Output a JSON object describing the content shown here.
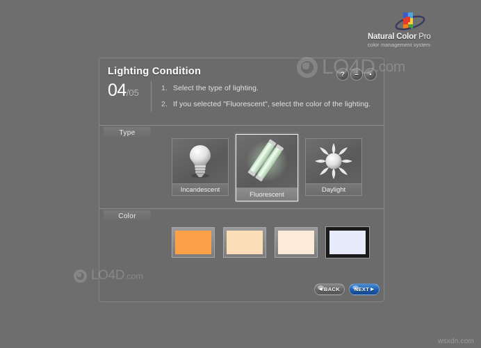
{
  "brand": {
    "name_part1": "Natural Color",
    "name_part2": " Pro",
    "tagline": "color management system",
    "logo_icon": "color-square-orbit-icon"
  },
  "header": {
    "title": "Lighting Condition",
    "step_current": "04",
    "step_total": "/05",
    "instructions": [
      {
        "num": "1.",
        "text": "Select the type of lighting."
      },
      {
        "num": "2.",
        "text": "If you selected \"Fluorescent\", select the color of the lighting."
      }
    ],
    "window_buttons": [
      {
        "name": "help-button",
        "glyph": "?"
      },
      {
        "name": "minimize-button",
        "glyph": "–"
      },
      {
        "name": "lock-button",
        "glyph": "▪"
      }
    ]
  },
  "type_section": {
    "tab_label": "Type",
    "tiles": [
      {
        "label": "Incandescent",
        "icon": "lightbulb-icon",
        "selected": false
      },
      {
        "label": "Fluorescent",
        "icon": "fluorescent-tube-icon",
        "selected": true
      },
      {
        "label": "Daylight",
        "icon": "sun-icon",
        "selected": false
      }
    ]
  },
  "color_section": {
    "tab_label": "Color",
    "swatches": [
      {
        "name": "color-swatch-warm-orange",
        "hex": "#FCA147",
        "selected": false
      },
      {
        "name": "color-swatch-light-peach",
        "hex": "#FBDDB8",
        "selected": false
      },
      {
        "name": "color-swatch-cream",
        "hex": "#FCEBD8",
        "selected": false
      },
      {
        "name": "color-swatch-cool-white",
        "hex": "#E8EBFA",
        "selected": true
      }
    ]
  },
  "navigation": {
    "back_label": "BACK",
    "next_label": "NEXT",
    "back_arrow": "◀",
    "next_arrow": "▶"
  },
  "watermarks": {
    "big": {
      "text": "LO4D",
      "domain": ".com"
    },
    "small": {
      "text": "LO4D",
      "domain": ".com"
    }
  },
  "footer": {
    "text": "wsxdn.com"
  }
}
